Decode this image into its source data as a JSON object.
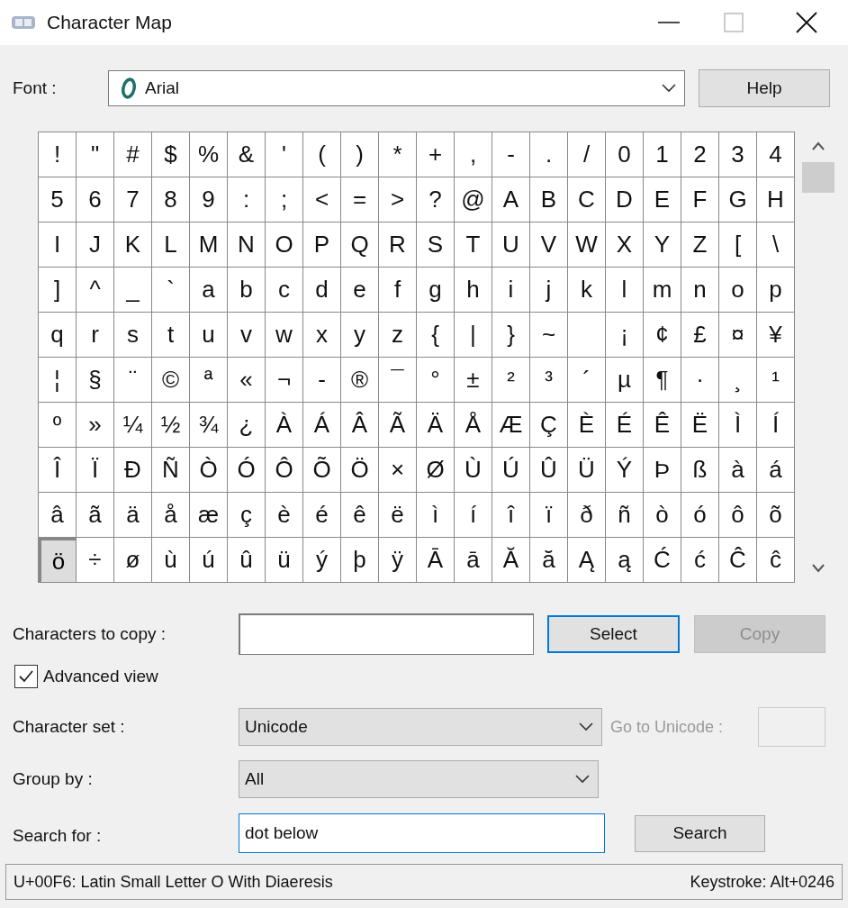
{
  "window": {
    "title": "Character Map"
  },
  "font": {
    "label": "Font :",
    "value": "Arial"
  },
  "help_button": {
    "label": "Help",
    "disabled": false
  },
  "grid": {
    "rows": [
      [
        {
          "char": "!",
          "selected": false
        },
        {
          "char": "\"",
          "selected": false
        },
        {
          "char": "#",
          "selected": false
        },
        {
          "char": "$",
          "selected": false
        },
        {
          "char": "%",
          "selected": false
        },
        {
          "char": "&",
          "selected": false
        },
        {
          "char": "'",
          "selected": false
        },
        {
          "char": "(",
          "selected": false
        },
        {
          "char": ")",
          "selected": false
        },
        {
          "char": "*",
          "selected": false
        },
        {
          "char": "+",
          "selected": false
        },
        {
          "char": ",",
          "selected": false
        },
        {
          "char": "-",
          "selected": false
        },
        {
          "char": ".",
          "selected": false
        },
        {
          "char": "/",
          "selected": false
        },
        {
          "char": "0",
          "selected": false
        },
        {
          "char": "1",
          "selected": false
        },
        {
          "char": "2",
          "selected": false
        },
        {
          "char": "3",
          "selected": false
        },
        {
          "char": "4",
          "selected": false
        }
      ],
      [
        {
          "char": "5",
          "selected": false
        },
        {
          "char": "6",
          "selected": false
        },
        {
          "char": "7",
          "selected": false
        },
        {
          "char": "8",
          "selected": false
        },
        {
          "char": "9",
          "selected": false
        },
        {
          "char": ":",
          "selected": false
        },
        {
          "char": ";",
          "selected": false
        },
        {
          "char": "<",
          "selected": false
        },
        {
          "char": "=",
          "selected": false
        },
        {
          "char": ">",
          "selected": false
        },
        {
          "char": "?",
          "selected": false
        },
        {
          "char": "@",
          "selected": false
        },
        {
          "char": "A",
          "selected": false
        },
        {
          "char": "B",
          "selected": false
        },
        {
          "char": "C",
          "selected": false
        },
        {
          "char": "D",
          "selected": false
        },
        {
          "char": "E",
          "selected": false
        },
        {
          "char": "F",
          "selected": false
        },
        {
          "char": "G",
          "selected": false
        },
        {
          "char": "H",
          "selected": false
        }
      ],
      [
        {
          "char": "I",
          "selected": false
        },
        {
          "char": "J",
          "selected": false
        },
        {
          "char": "K",
          "selected": false
        },
        {
          "char": "L",
          "selected": false
        },
        {
          "char": "M",
          "selected": false
        },
        {
          "char": "N",
          "selected": false
        },
        {
          "char": "O",
          "selected": false
        },
        {
          "char": "P",
          "selected": false
        },
        {
          "char": "Q",
          "selected": false
        },
        {
          "char": "R",
          "selected": false
        },
        {
          "char": "S",
          "selected": false
        },
        {
          "char": "T",
          "selected": false
        },
        {
          "char": "U",
          "selected": false
        },
        {
          "char": "V",
          "selected": false
        },
        {
          "char": "W",
          "selected": false
        },
        {
          "char": "X",
          "selected": false
        },
        {
          "char": "Y",
          "selected": false
        },
        {
          "char": "Z",
          "selected": false
        },
        {
          "char": "[",
          "selected": false
        },
        {
          "char": "\\",
          "selected": false
        }
      ],
      [
        {
          "char": "]",
          "selected": false
        },
        {
          "char": "^",
          "selected": false
        },
        {
          "char": "_",
          "selected": false
        },
        {
          "char": "`",
          "selected": false
        },
        {
          "char": "a",
          "selected": false
        },
        {
          "char": "b",
          "selected": false
        },
        {
          "char": "c",
          "selected": false
        },
        {
          "char": "d",
          "selected": false
        },
        {
          "char": "e",
          "selected": false
        },
        {
          "char": "f",
          "selected": false
        },
        {
          "char": "g",
          "selected": false
        },
        {
          "char": "h",
          "selected": false
        },
        {
          "char": "i",
          "selected": false
        },
        {
          "char": "j",
          "selected": false
        },
        {
          "char": "k",
          "selected": false
        },
        {
          "char": "l",
          "selected": false
        },
        {
          "char": "m",
          "selected": false
        },
        {
          "char": "n",
          "selected": false
        },
        {
          "char": "o",
          "selected": false
        },
        {
          "char": "p",
          "selected": false
        }
      ],
      [
        {
          "char": "q",
          "selected": false
        },
        {
          "char": "r",
          "selected": false
        },
        {
          "char": "s",
          "selected": false
        },
        {
          "char": "t",
          "selected": false
        },
        {
          "char": "u",
          "selected": false
        },
        {
          "char": "v",
          "selected": false
        },
        {
          "char": "w",
          "selected": false
        },
        {
          "char": "x",
          "selected": false
        },
        {
          "char": "y",
          "selected": false
        },
        {
          "char": "z",
          "selected": false
        },
        {
          "char": "{",
          "selected": false
        },
        {
          "char": "|",
          "selected": false
        },
        {
          "char": "}",
          "selected": false
        },
        {
          "char": "~",
          "selected": false
        },
        {
          "selected": false
        },
        {
          "char": "¡",
          "selected": false
        },
        {
          "char": "¢",
          "selected": false
        },
        {
          "char": "£",
          "selected": false
        },
        {
          "char": "¤",
          "selected": false
        },
        {
          "char": "¥",
          "selected": false
        }
      ],
      [
        {
          "char": "¦",
          "selected": false
        },
        {
          "char": "§",
          "selected": false
        },
        {
          "char": "¨",
          "selected": false
        },
        {
          "char": "©",
          "selected": false
        },
        {
          "char": "ª",
          "selected": false
        },
        {
          "char": "«",
          "selected": false
        },
        {
          "char": "¬",
          "selected": false
        },
        {
          "char": "-",
          "selected": false
        },
        {
          "char": "®",
          "selected": false
        },
        {
          "char": "¯",
          "selected": false
        },
        {
          "char": "°",
          "selected": false
        },
        {
          "char": "±",
          "selected": false
        },
        {
          "char": "²",
          "selected": false
        },
        {
          "char": "³",
          "selected": false
        },
        {
          "char": "´",
          "selected": false
        },
        {
          "char": "µ",
          "selected": false
        },
        {
          "char": "¶",
          "selected": false
        },
        {
          "char": "·",
          "selected": false
        },
        {
          "char": "¸",
          "selected": false
        },
        {
          "char": "¹",
          "selected": false
        }
      ],
      [
        {
          "char": "º",
          "selected": false
        },
        {
          "char": "»",
          "selected": false
        },
        {
          "char": "¼",
          "selected": false
        },
        {
          "char": "½",
          "selected": false
        },
        {
          "char": "¾",
          "selected": false
        },
        {
          "char": "¿",
          "selected": false
        },
        {
          "char": "À",
          "selected": false
        },
        {
          "char": "Á",
          "selected": false
        },
        {
          "char": "Â",
          "selected": false
        },
        {
          "char": "Ã",
          "selected": false
        },
        {
          "char": "Ä",
          "selected": false
        },
        {
          "char": "Å",
          "selected": false
        },
        {
          "char": "Æ",
          "selected": false
        },
        {
          "char": "Ç",
          "selected": false
        },
        {
          "char": "È",
          "selected": false
        },
        {
          "char": "É",
          "selected": false
        },
        {
          "char": "Ê",
          "selected": false
        },
        {
          "char": "Ë",
          "selected": false
        },
        {
          "char": "Ì",
          "selected": false
        },
        {
          "char": "Í",
          "selected": false
        }
      ],
      [
        {
          "char": "Î",
          "selected": false
        },
        {
          "char": "Ï",
          "selected": false
        },
        {
          "char": "Ð",
          "selected": false
        },
        {
          "char": "Ñ",
          "selected": false
        },
        {
          "char": "Ò",
          "selected": false
        },
        {
          "char": "Ó",
          "selected": false
        },
        {
          "char": "Ô",
          "selected": false
        },
        {
          "char": "Õ",
          "selected": false
        },
        {
          "char": "Ö",
          "selected": false
        },
        {
          "char": "×",
          "selected": false
        },
        {
          "char": "Ø",
          "selected": false
        },
        {
          "char": "Ù",
          "selected": false
        },
        {
          "char": "Ú",
          "selected": false
        },
        {
          "char": "Û",
          "selected": false
        },
        {
          "char": "Ü",
          "selected": false
        },
        {
          "char": "Ý",
          "selected": false
        },
        {
          "char": "Þ",
          "selected": false
        },
        {
          "char": "ß",
          "selected": false
        },
        {
          "char": "à",
          "selected": false
        },
        {
          "char": "á",
          "selected": false
        }
      ],
      [
        {
          "char": "â",
          "selected": false
        },
        {
          "char": "ã",
          "selected": false
        },
        {
          "char": "ä",
          "selected": false
        },
        {
          "char": "å",
          "selected": false
        },
        {
          "char": "æ",
          "selected": false
        },
        {
          "char": "ç",
          "selected": false
        },
        {
          "char": "è",
          "selected": false
        },
        {
          "char": "é",
          "selected": false
        },
        {
          "char": "ê",
          "selected": false
        },
        {
          "char": "ë",
          "selected": false
        },
        {
          "char": "ì",
          "selected": false
        },
        {
          "char": "í",
          "selected": false
        },
        {
          "char": "î",
          "selected": false
        },
        {
          "char": "ï",
          "selected": false
        },
        {
          "char": "ð",
          "selected": false
        },
        {
          "char": "ñ",
          "selected": false
        },
        {
          "char": "ò",
          "selected": false
        },
        {
          "char": "ó",
          "selected": false
        },
        {
          "char": "ô",
          "selected": false
        },
        {
          "char": "õ",
          "selected": false
        }
      ],
      [
        {
          "char": "ö",
          "selected": true
        },
        {
          "char": "÷",
          "selected": false
        },
        {
          "char": "ø",
          "selected": false
        },
        {
          "char": "ù",
          "selected": false
        },
        {
          "char": "ú",
          "selected": false
        },
        {
          "char": "û",
          "selected": false
        },
        {
          "char": "ü",
          "selected": false
        },
        {
          "char": "ý",
          "selected": false
        },
        {
          "char": "þ",
          "selected": false
        },
        {
          "char": "ÿ",
          "selected": false
        },
        {
          "char": "Ā",
          "selected": false
        },
        {
          "char": "ā",
          "selected": false
        },
        {
          "char": "Ă",
          "selected": false
        },
        {
          "char": "ă",
          "selected": false
        },
        {
          "char": "Ą",
          "selected": false
        },
        {
          "char": "ą",
          "selected": false
        },
        {
          "char": "Ć",
          "selected": false
        },
        {
          "char": "ć",
          "selected": false
        },
        {
          "char": "Ĉ",
          "selected": false
        },
        {
          "char": "ĉ",
          "selected": false
        }
      ]
    ]
  },
  "copy_row": {
    "label": "Characters to copy :",
    "select_button": {
      "label": "Select",
      "disabled": false,
      "focused": true
    },
    "copy_button": {
      "label": "Copy",
      "disabled": true
    }
  },
  "advanced_view": {
    "label": "Advanced view",
    "checked": true
  },
  "character_set": {
    "label": "Character set :",
    "value": "Unicode"
  },
  "go_to_unicode": {
    "label": "Go to Unicode :",
    "disabled": true
  },
  "group_by": {
    "label": "Group by :",
    "value": "All"
  },
  "search": {
    "label": "Search for :",
    "value": "dot below",
    "button": {
      "label": "Search",
      "disabled": false,
      "focused": false
    }
  },
  "status_bar": {
    "description": "U+00F6: Latin Small Letter O With Diaeresis",
    "keystroke": "Keystroke: Alt+0246"
  }
}
